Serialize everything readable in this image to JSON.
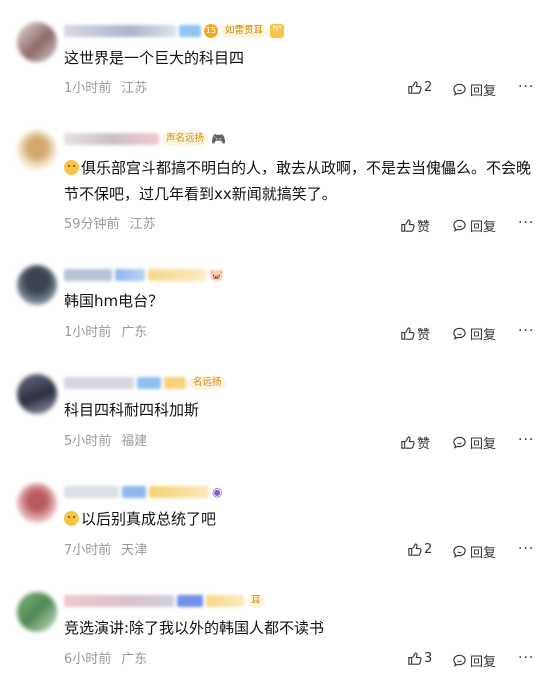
{
  "comments": [
    {
      "text": "这世界是一个巨大的科目四",
      "time": "1小时前",
      "location": "江苏",
      "like": "2",
      "reply": "回复",
      "badge": "如雷贯耳",
      "badge_level": "15",
      "emoji": false
    },
    {
      "text": "俱乐部宫斗都搞不明白的人，敢去从政啊，不是去当傀儡么。不会晚节不保吧，过几年看到xx新闻就搞笑了。",
      "time": "59分钟前",
      "location": "江苏",
      "like": "赞",
      "reply": "回复",
      "badge": "声名远扬",
      "emoji": true
    },
    {
      "text": "韩国hm电台？",
      "time": "1小时前",
      "location": "广东",
      "like": "赞",
      "reply": "回复",
      "badge": "",
      "emoji": false
    },
    {
      "text": "科目四科耐四科加斯",
      "time": "5小时前",
      "location": "福建",
      "like": "赞",
      "reply": "回复",
      "badge": "名远扬",
      "emoji": false
    },
    {
      "text": "以后别真成总统了吧",
      "time": "7小时前",
      "location": "天津",
      "like": "2",
      "reply": "回复",
      "badge": "",
      "emoji": true
    },
    {
      "text": "竞选演讲:除了我以外的韩国人都不读书",
      "time": "6小时前",
      "location": "广东",
      "like": "3",
      "reply": "回复",
      "badge": "耳",
      "emoji": false
    }
  ],
  "more_label": "···"
}
